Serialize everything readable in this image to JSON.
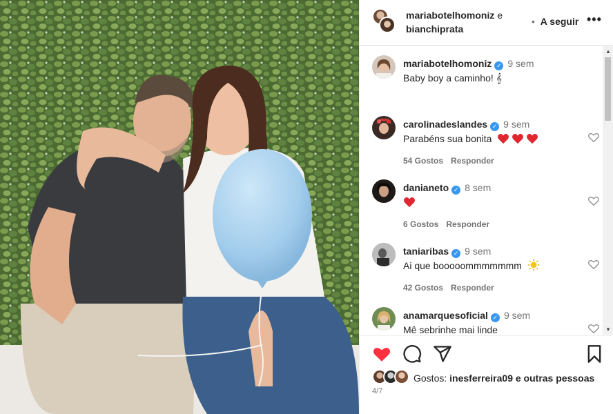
{
  "header": {
    "user1": "mariabotelhomoniz",
    "and": "e",
    "user2": "bianchiprata",
    "dot": "•",
    "follow": "A seguir",
    "more": "•••"
  },
  "caption": {
    "user": "mariabotelhomoniz",
    "time": "9 sem",
    "text": "Baby boy a caminho! 𝄞"
  },
  "comments": [
    {
      "user": "carolinadeslandes",
      "time": "9 sem",
      "text": "Parabéns sua bonita",
      "hearts": 3,
      "likes": "54 Gostos",
      "reply": "Responder"
    },
    {
      "user": "danianeto",
      "time": "8 sem",
      "text": "",
      "hearts": 1,
      "likes": "6 Gostos",
      "reply": "Responder"
    },
    {
      "user": "taniaribas",
      "time": "9 sem",
      "text": "Ai que booooommmmmmm",
      "hearts": 0,
      "likes": "42 Gostos",
      "reply": "Responder"
    },
    {
      "user": "anamarquesoficial",
      "time": "9 sem",
      "text": "Mê sebrinhe mai linde",
      "hearts": 0,
      "likes": "",
      "reply": ""
    }
  ],
  "likes": {
    "prefix": "Gostos:",
    "user": "inesferreira09",
    "suffix": "e outras pessoas"
  },
  "page_indicator": "4/7",
  "colors": {
    "like_red": "#ff3040",
    "verified_blue": "#3897f0",
    "balloon": "#a9d3f0"
  }
}
